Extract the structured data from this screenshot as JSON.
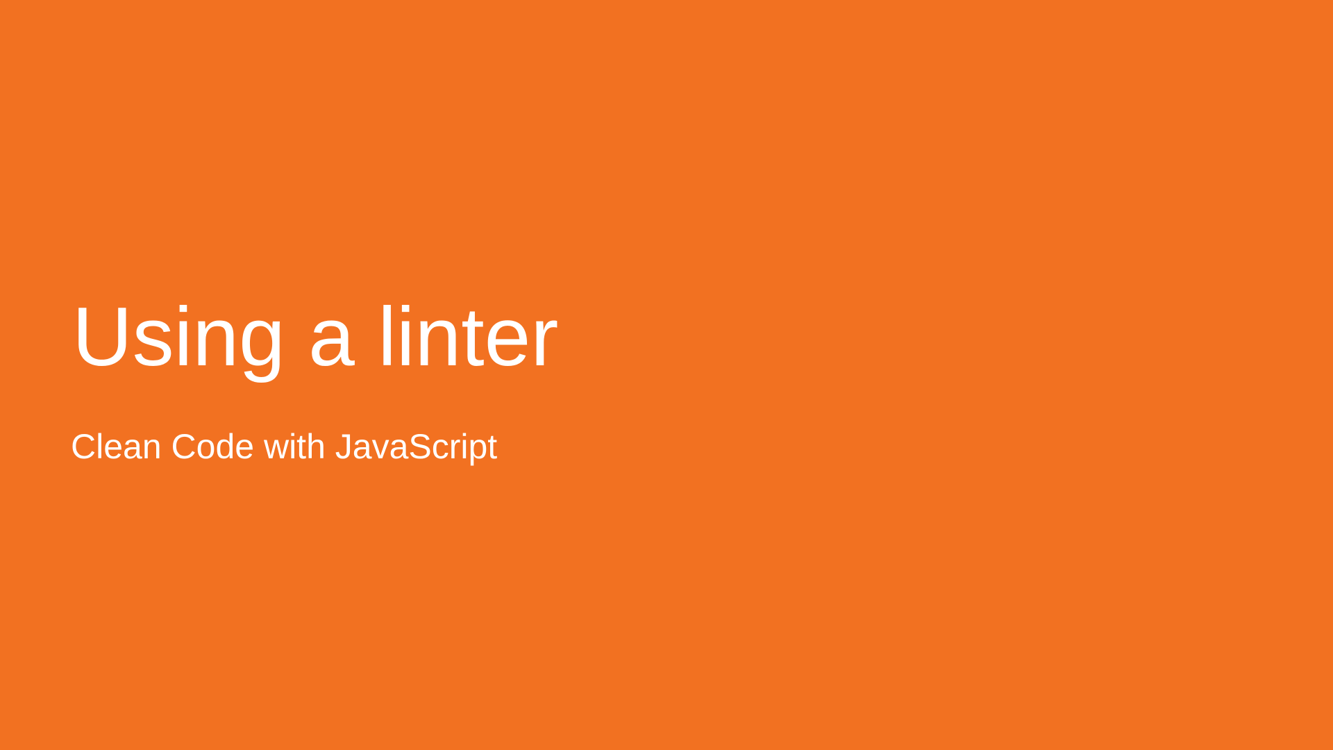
{
  "slide": {
    "background_color": "#f27121",
    "text_color": "#ffffff",
    "title": "Using a linter",
    "subtitle": "Clean Code with JavaScript"
  }
}
